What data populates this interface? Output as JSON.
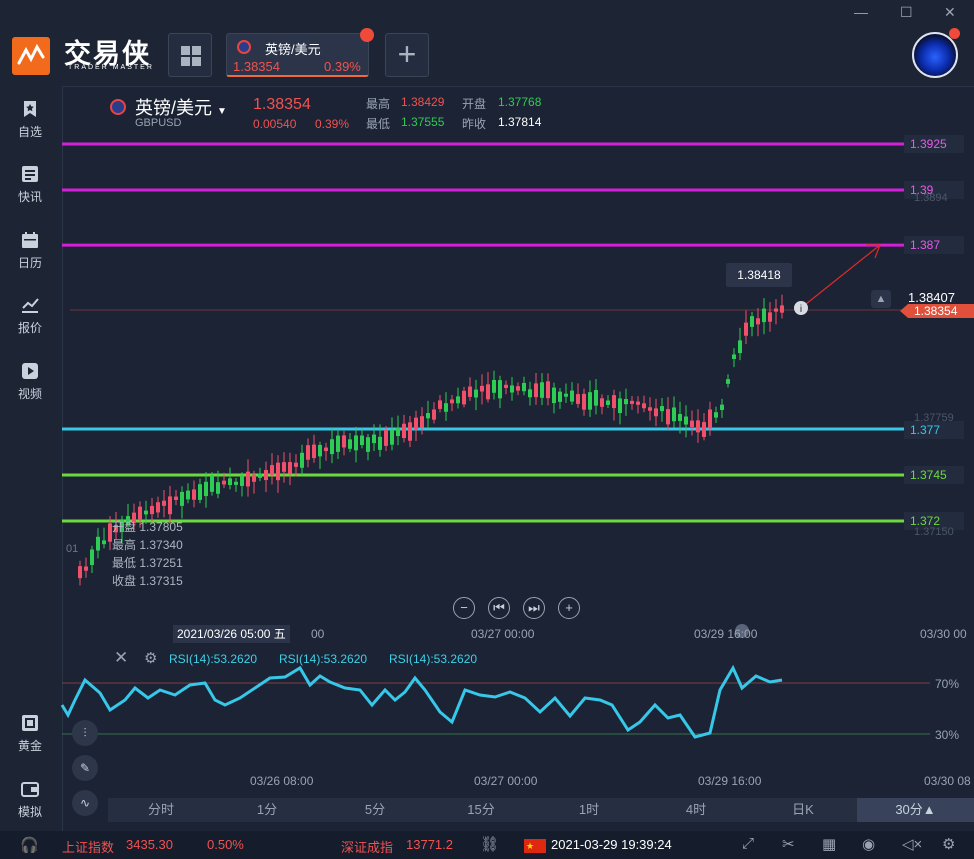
{
  "app": {
    "name": "交易侠",
    "subtitle": "TRADER MASTER"
  },
  "tab": {
    "symbol": "英镑/美元",
    "price": "1.38354",
    "change_pct": "0.39%"
  },
  "window": {
    "minimize": "—",
    "maximize": "☐",
    "close": "✕"
  },
  "sidebar": {
    "items": [
      {
        "label": "自选",
        "icon": "star-bookmark-icon"
      },
      {
        "label": "快讯",
        "icon": "news-list-icon"
      },
      {
        "label": "日历",
        "icon": "calendar-icon"
      },
      {
        "label": "报价",
        "icon": "trend-line-icon"
      },
      {
        "label": "视频",
        "icon": "play-icon"
      },
      {
        "label": "黄金",
        "icon": "gold-bar-icon"
      },
      {
        "label": "模拟",
        "icon": "wallet-icon"
      }
    ]
  },
  "header": {
    "name": "英镑/美元",
    "code": "GBPUSD",
    "price": "1.38354",
    "change": "0.00540",
    "change_pct": "0.39%",
    "high_label": "最高",
    "high": "1.38429",
    "open_label": "开盘",
    "open": "1.37768",
    "low_label": "最低",
    "low": "1.37555",
    "prev_label": "昨收",
    "prev": "1.37814"
  },
  "levels": [
    {
      "label": "1.3925",
      "value": 1.3925,
      "color": "#d51fd8"
    },
    {
      "label": "1.39",
      "value": 1.39,
      "color": "#d51fd8"
    },
    {
      "label": "1.387",
      "value": 1.387,
      "color": "#d51fd8"
    },
    {
      "label": "1.377",
      "value": 1.377,
      "color": "#37c7e8"
    },
    {
      "label": "1.3745",
      "value": 1.3745,
      "color": "#6ed93f"
    },
    {
      "label": "1.372",
      "value": 1.372,
      "color": "#6ed93f"
    }
  ],
  "axis_faded": {
    "top": "1.3894",
    "mid": "1.37759",
    "bottom": "1.37150"
  },
  "current": {
    "price_label": "1.38407",
    "last_label": "1.38354",
    "tooltip": "1.38418"
  },
  "ohlc_tooltip": {
    "open_label": "开盘",
    "open": "1.37805",
    "high_label": "最高",
    "high": "1.37340",
    "low_label": "最低",
    "low": "1.37251",
    "close_label": "收盘",
    "close": "1.37315",
    "extra": "01"
  },
  "time_axis": {
    "crosshair": "2021/03/26 05:00 五",
    "main_ticks": [
      "00",
      "03/27 00:00",
      "03/29 16:00",
      "03/30 00"
    ],
    "rsi_ticks": [
      "03/26 08:00",
      "03/27 00:00",
      "03/29 16:00",
      "03/30 08"
    ]
  },
  "rsi": {
    "label1": "RSI(14):53.2620",
    "label2": "RSI(14):53.2620",
    "label3": "RSI(14):53.2620",
    "level_high": "70%",
    "level_low": "30%"
  },
  "timeframes": [
    "分时",
    "1分",
    "5分",
    "15分",
    "1时",
    "4时",
    "日K",
    "30分▲"
  ],
  "statusbar": {
    "index1_name": "上证指数",
    "index1_value": "3435.30",
    "index1_pct": "0.50%",
    "index2_name": "深证成指",
    "index2_value": "13771.2",
    "datetime": "2021-03-29 19:39:24"
  },
  "colors": {
    "up": "#f0506a",
    "down": "#2ecc52",
    "accent": "#f06a3c"
  }
}
